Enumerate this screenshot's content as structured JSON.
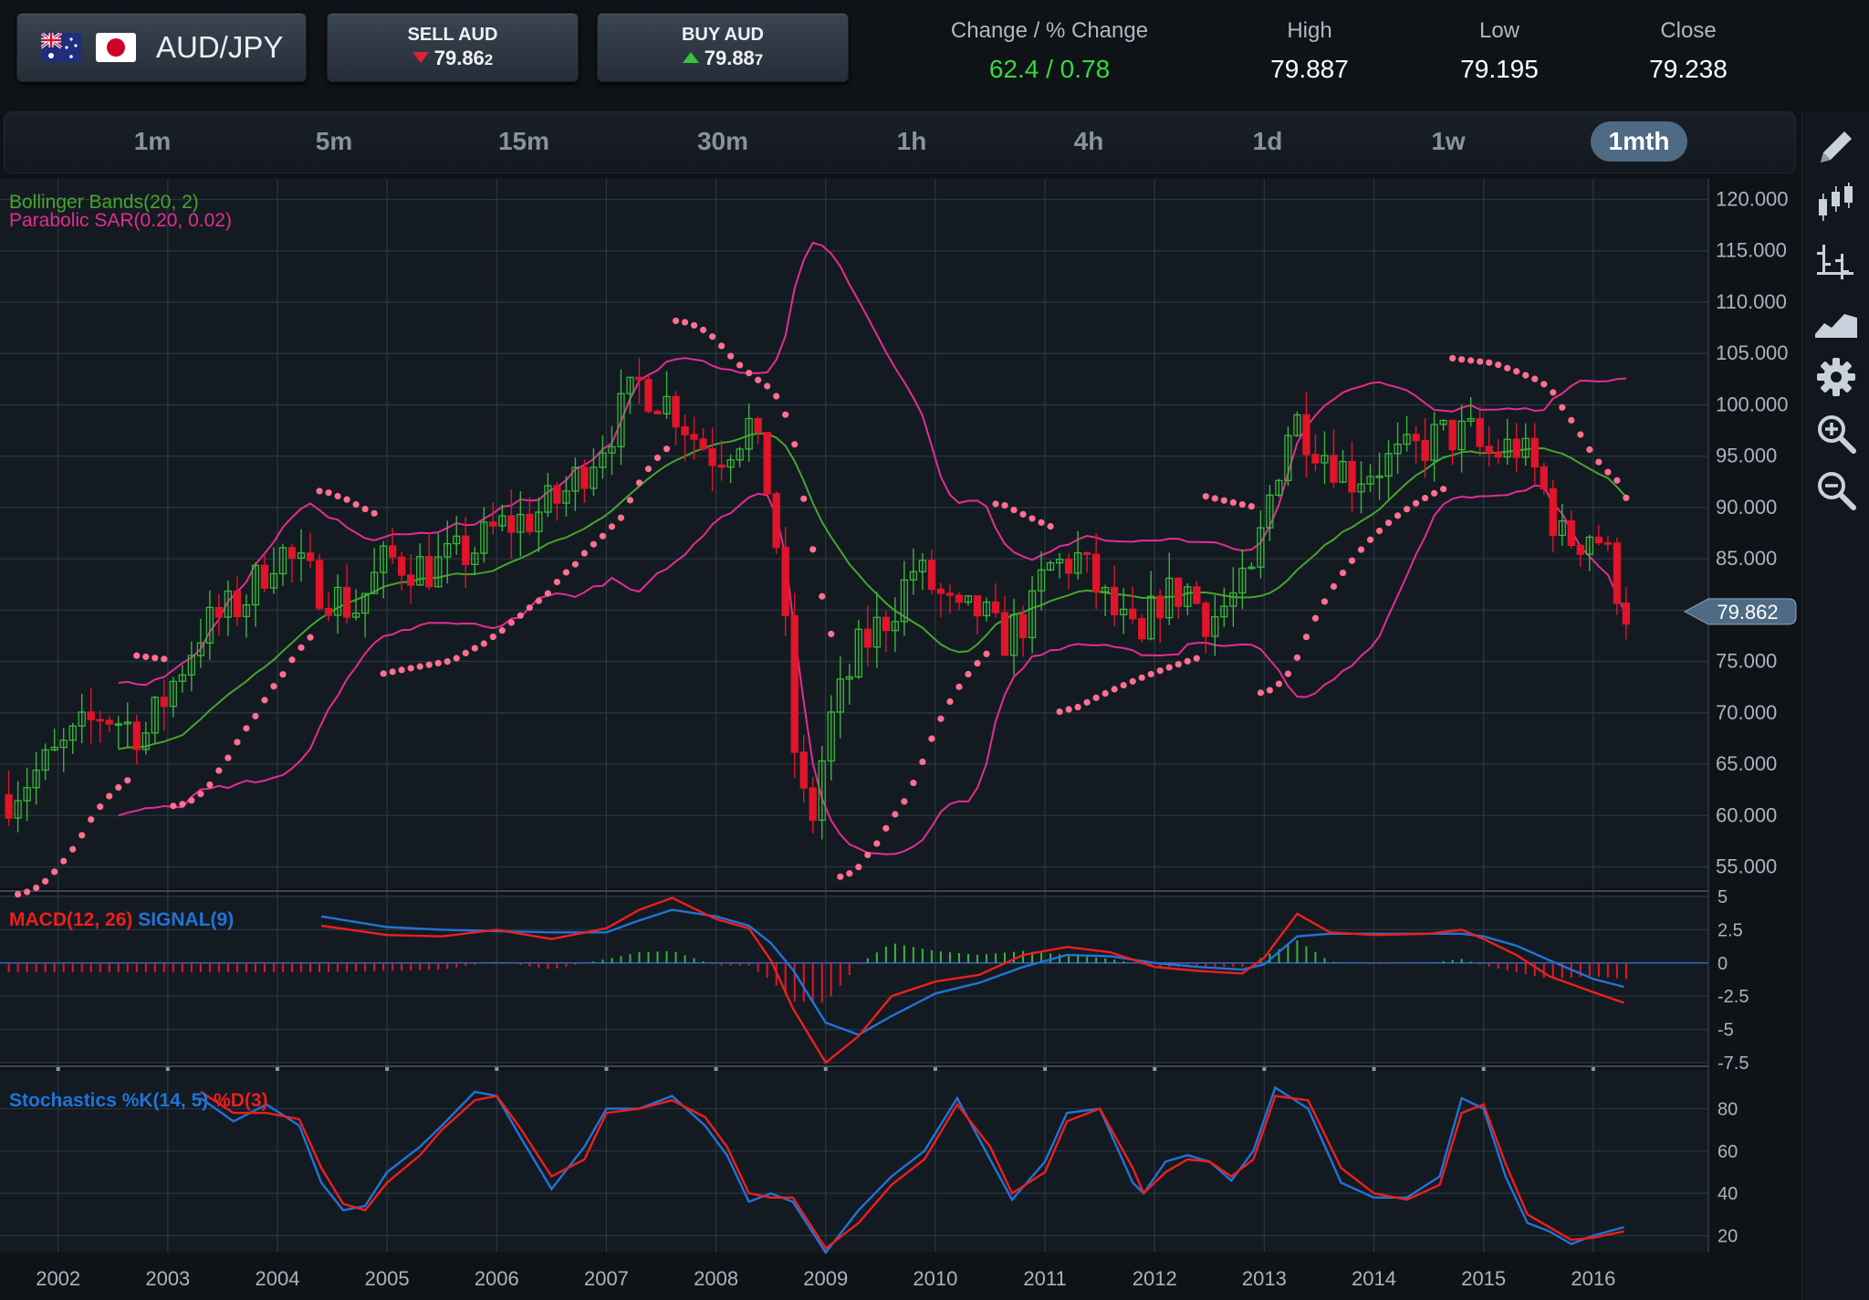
{
  "header": {
    "pair": "AUD/JPY",
    "sell": {
      "label": "SELL AUD",
      "price_main": "79.86",
      "price_pip": "2"
    },
    "buy": {
      "label": "BUY AUD",
      "price_main": "79.88",
      "price_pip": "7"
    },
    "stats": {
      "change_label": "Change / % Change",
      "change_value": "62.4 / 0.78",
      "high_label": "High",
      "high_value": "79.887",
      "low_label": "Low",
      "low_value": "79.195",
      "close_label": "Close",
      "close_value": "79.238"
    }
  },
  "timeframes": [
    {
      "label": "1m"
    },
    {
      "label": "5m"
    },
    {
      "label": "15m"
    },
    {
      "label": "30m"
    },
    {
      "label": "1h"
    },
    {
      "label": "4h"
    },
    {
      "label": "1d"
    },
    {
      "label": "1w"
    },
    {
      "label": "1mth",
      "active": true
    }
  ],
  "tools": [
    "pencil-icon",
    "candlestick-icon",
    "ohlc-bars-icon",
    "area-chart-icon",
    "gear-icon",
    "zoom-in-icon",
    "zoom-out-icon"
  ],
  "colors": {
    "up": "#37b63a",
    "down": "#e0152a",
    "bollinger_mid": "#46a52c",
    "bollinger_band": "#e22d95",
    "sar": "#ff6f8f",
    "macd": "#ec1f1f",
    "signal": "#1f74d8",
    "accent": "#4e6a84"
  },
  "chart_data": [
    {
      "type": "candlestick",
      "legend": [
        "Bollinger Bands(20, 2)",
        "Parabolic SAR(0.20, 0.02)"
      ],
      "y_ticks": [
        "120.000",
        "115.000",
        "110.000",
        "105.000",
        "100.000",
        "95.000",
        "90.000",
        "85.000",
        "80.000",
        "75.000",
        "70.000",
        "65.000",
        "60.000",
        "55.000"
      ],
      "ylim": [
        53,
        122
      ],
      "x_ticks": [
        "2002",
        "2003",
        "2004",
        "2005",
        "2006",
        "2007",
        "2008",
        "2009",
        "2010",
        "2011",
        "2012",
        "2013",
        "2014",
        "2015",
        "2016"
      ],
      "xlim": [
        2001.47,
        2017.05
      ],
      "current_price": "79.862",
      "close_series": {
        "x": [
          2001.55,
          2002.0,
          2002.4,
          2002.8,
          2003.0,
          2003.3,
          2003.7,
          2004.0,
          2004.3,
          2004.7,
          2005.0,
          2005.4,
          2005.8,
          2006.0,
          2006.3,
          2006.6,
          2007.0,
          2007.3,
          2007.6,
          2007.8,
          2008.0,
          2008.3,
          2008.5,
          2008.6,
          2008.75,
          2008.9,
          2009.0,
          2009.3,
          2009.6,
          2009.8,
          2010.0,
          2010.2,
          2010.4,
          2010.6,
          2010.9,
          2011.0,
          2011.3,
          2011.6,
          2011.9,
          2012.0,
          2012.3,
          2012.5,
          2012.7,
          2012.9,
          2013.0,
          2013.25,
          2013.5,
          2013.8,
          2014.0,
          2014.3,
          2014.6,
          2014.9,
          2015.0,
          2015.3,
          2015.5,
          2015.7,
          2015.9,
          2016.0,
          2016.1,
          2016.2,
          2016.28
        ],
        "y": [
          62,
          66,
          70,
          68,
          72,
          78,
          81,
          86,
          83,
          80,
          85,
          84,
          86,
          88,
          89,
          91,
          97,
          102,
          100,
          97,
          95,
          98,
          91,
          82,
          62,
          60,
          68,
          76,
          80,
          84,
          82,
          79,
          80,
          77,
          80,
          84,
          85,
          80,
          76,
          81,
          82,
          79,
          81,
          83,
          89,
          99,
          96,
          93,
          94,
          95,
          97,
          97,
          95,
          96,
          93,
          87,
          87,
          88,
          86,
          83,
          80
        ]
      }
    },
    {
      "type": "line",
      "legend": [
        "MACD(12, 26)",
        "SIGNAL(9)"
      ],
      "y_ticks": [
        "5",
        "2.5",
        "0",
        "-2.5",
        "-5",
        "-7.5"
      ],
      "ylim": [
        -7.5,
        5
      ],
      "series": [
        {
          "name": "MACD(12, 26)",
          "x": [
            2004.4,
            2005.0,
            2005.5,
            2006.0,
            2006.5,
            2007.0,
            2007.3,
            2007.6,
            2008.0,
            2008.3,
            2008.5,
            2008.7,
            2009.0,
            2009.3,
            2009.6,
            2010.0,
            2010.4,
            2010.8,
            2011.2,
            2011.6,
            2012.0,
            2012.4,
            2012.8,
            2013.0,
            2013.3,
            2013.6,
            2014.0,
            2014.5,
            2014.8,
            2015.0,
            2015.3,
            2015.6,
            2016.0,
            2016.28
          ],
          "y": [
            2.8,
            2.1,
            2.0,
            2.5,
            1.8,
            2.6,
            4.0,
            4.9,
            3.3,
            2.6,
            0.2,
            -3.4,
            -7.5,
            -5.5,
            -2.5,
            -1.4,
            -0.9,
            0.6,
            1.2,
            0.8,
            -0.3,
            -0.6,
            -0.8,
            0.4,
            3.7,
            2.3,
            2.1,
            2.2,
            2.5,
            1.8,
            0.6,
            -1.0,
            -2.2,
            -3.0
          ]
        },
        {
          "name": "SIGNAL(9)",
          "x": [
            2004.4,
            2005.0,
            2005.5,
            2006.0,
            2006.5,
            2007.0,
            2007.3,
            2007.6,
            2008.0,
            2008.3,
            2008.5,
            2008.7,
            2009.0,
            2009.3,
            2009.6,
            2010.0,
            2010.4,
            2010.8,
            2011.2,
            2011.6,
            2012.0,
            2012.4,
            2012.8,
            2013.0,
            2013.3,
            2013.6,
            2014.0,
            2014.5,
            2014.8,
            2015.0,
            2015.3,
            2015.6,
            2016.0,
            2016.28
          ],
          "y": [
            3.5,
            2.7,
            2.5,
            2.4,
            2.3,
            2.3,
            3.2,
            4.0,
            3.5,
            2.8,
            1.5,
            -0.5,
            -4.5,
            -5.4,
            -4.0,
            -2.3,
            -1.5,
            -0.3,
            0.6,
            0.5,
            0.0,
            -0.3,
            -0.5,
            -0.1,
            2.0,
            2.2,
            2.2,
            2.2,
            2.2,
            2.0,
            1.3,
            0.2,
            -1.2,
            -1.8
          ]
        }
      ]
    },
    {
      "type": "line",
      "legend": [
        "Stochastics %K(14, 5)",
        "%D(3)"
      ],
      "y_ticks": [
        "80",
        "60",
        "40",
        "20"
      ],
      "ylim": [
        12,
        94
      ],
      "series": [
        {
          "name": "Stochastics %K(14, 5)",
          "x": [
            2003.3,
            2003.6,
            2003.9,
            2004.2,
            2004.4,
            2004.6,
            2004.8,
            2005.0,
            2005.3,
            2005.5,
            2005.8,
            2006.0,
            2006.2,
            2006.5,
            2006.8,
            2007.0,
            2007.3,
            2007.6,
            2007.9,
            2008.1,
            2008.3,
            2008.5,
            2008.7,
            2009.0,
            2009.3,
            2009.6,
            2009.9,
            2010.2,
            2010.5,
            2010.7,
            2011.0,
            2011.2,
            2011.5,
            2011.8,
            2011.9,
            2012.1,
            2012.3,
            2012.5,
            2012.7,
            2012.9,
            2013.1,
            2013.4,
            2013.7,
            2014.0,
            2014.3,
            2014.6,
            2014.8,
            2015.0,
            2015.2,
            2015.4,
            2015.6,
            2015.8,
            2016.0,
            2016.28
          ],
          "y": [
            85,
            74,
            82,
            72,
            45,
            32,
            34,
            50,
            62,
            72,
            88,
            86,
            68,
            42,
            62,
            80,
            80,
            86,
            72,
            58,
            36,
            40,
            36,
            12,
            32,
            48,
            60,
            85,
            56,
            37,
            55,
            78,
            80,
            45,
            40,
            55,
            58,
            55,
            46,
            60,
            90,
            80,
            45,
            38,
            38,
            48,
            85,
            80,
            48,
            26,
            22,
            16,
            20,
            24
          ]
        },
        {
          "name": "%D(3)",
          "x": [
            2003.3,
            2003.6,
            2003.9,
            2004.2,
            2004.4,
            2004.6,
            2004.8,
            2005.0,
            2005.3,
            2005.5,
            2005.8,
            2006.0,
            2006.2,
            2006.5,
            2006.8,
            2007.0,
            2007.3,
            2007.6,
            2007.9,
            2008.1,
            2008.3,
            2008.5,
            2008.7,
            2009.0,
            2009.3,
            2009.6,
            2009.9,
            2010.2,
            2010.5,
            2010.7,
            2011.0,
            2011.2,
            2011.5,
            2011.8,
            2011.9,
            2012.1,
            2012.3,
            2012.5,
            2012.7,
            2012.9,
            2013.1,
            2013.4,
            2013.7,
            2014.0,
            2014.3,
            2014.6,
            2014.8,
            2015.0,
            2015.2,
            2015.4,
            2015.6,
            2015.8,
            2016.0,
            2016.28
          ],
          "y": [
            88,
            78,
            78,
            75,
            52,
            35,
            32,
            45,
            58,
            70,
            84,
            86,
            72,
            48,
            56,
            78,
            80,
            84,
            76,
            62,
            40,
            38,
            38,
            14,
            26,
            44,
            56,
            82,
            62,
            40,
            50,
            74,
            80,
            52,
            40,
            50,
            56,
            55,
            48,
            56,
            86,
            84,
            52,
            40,
            37,
            44,
            78,
            82,
            54,
            30,
            24,
            18,
            19,
            22
          ]
        }
      ]
    }
  ]
}
